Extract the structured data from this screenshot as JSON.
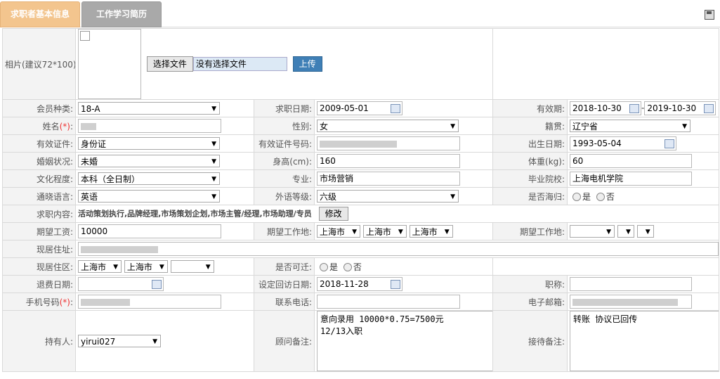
{
  "tabs": {
    "basic": "求职者基本信息",
    "work": "工作学习简历"
  },
  "photo": {
    "label": "相片(建议72*100):",
    "choose_file": "选择文件",
    "no_file": "没有选择文件",
    "upload": "上传"
  },
  "member_type": {
    "label": "会员种类:",
    "value": "18-A"
  },
  "job_date": {
    "label": "求职日期:",
    "value": "2009-05-01"
  },
  "validity": {
    "label": "有效期:",
    "start": "2018-10-30",
    "end": "2019-10-30",
    "sep": "-"
  },
  "name": {
    "label": "姓名",
    "req": "(*)",
    "colon": ":"
  },
  "gender": {
    "label": "性别:",
    "value": "女"
  },
  "native": {
    "label": "籍贯:",
    "value": "辽宁省"
  },
  "id_type": {
    "label": "有效证件:",
    "value": "身份证"
  },
  "id_number": {
    "label": "有效证件号码:"
  },
  "birth": {
    "label": "出生日期:",
    "value": "1993-05-04"
  },
  "marital": {
    "label": "婚姻状况:",
    "value": "未婚"
  },
  "height": {
    "label": "身高(cm):",
    "value": "160"
  },
  "weight": {
    "label": "体重(kg):",
    "value": "60"
  },
  "education": {
    "label": "文化程度:",
    "value": "本科（全日制）"
  },
  "major": {
    "label": "专业:",
    "value": "市场营销"
  },
  "school": {
    "label": "毕业院校:",
    "value": "上海电机学院"
  },
  "language": {
    "label": "通晓语言:",
    "value": "英语"
  },
  "foreign_level": {
    "label": "外语等级:",
    "value": "六级"
  },
  "returnee": {
    "label": "是否海归:",
    "yes": "是",
    "no": "否"
  },
  "job_content": {
    "label": "求职内容:",
    "value": "活动策划执行,品牌经理,市场策划企划,市场主管/经理,市场助理/专员",
    "edit": "修改"
  },
  "salary": {
    "label": "期望工资:",
    "value": "10000"
  },
  "workplace1": {
    "label": "期望工作地:",
    "a": "上海市",
    "b": "上海市",
    "c": "上海市"
  },
  "workplace2": {
    "label": "期望工作地:"
  },
  "address": {
    "label": "现居住址:"
  },
  "district": {
    "label": "现居住区:",
    "a": "上海市",
    "b": "上海市"
  },
  "relocate": {
    "label": "是否可迁:",
    "yes": "是",
    "no": "否"
  },
  "refund_date": {
    "label": "退费日期:"
  },
  "visit_date": {
    "label": "设定回访日期:",
    "value": "2018-11-28"
  },
  "title": {
    "label": "职称:"
  },
  "mobile": {
    "label": "手机号码",
    "req": "(*)",
    "colon": ":"
  },
  "phone": {
    "label": "联系电话:"
  },
  "email": {
    "label": "电子邮箱:"
  },
  "holder": {
    "label": "持有人:",
    "value": "yirui027"
  },
  "consultant_note": {
    "label": "顾问备注:",
    "value": "意向录用 10000*0.75=7500元\n12/13入职"
  },
  "reception_note": {
    "label": "接待备注:",
    "value": "转账 协议已回传"
  }
}
